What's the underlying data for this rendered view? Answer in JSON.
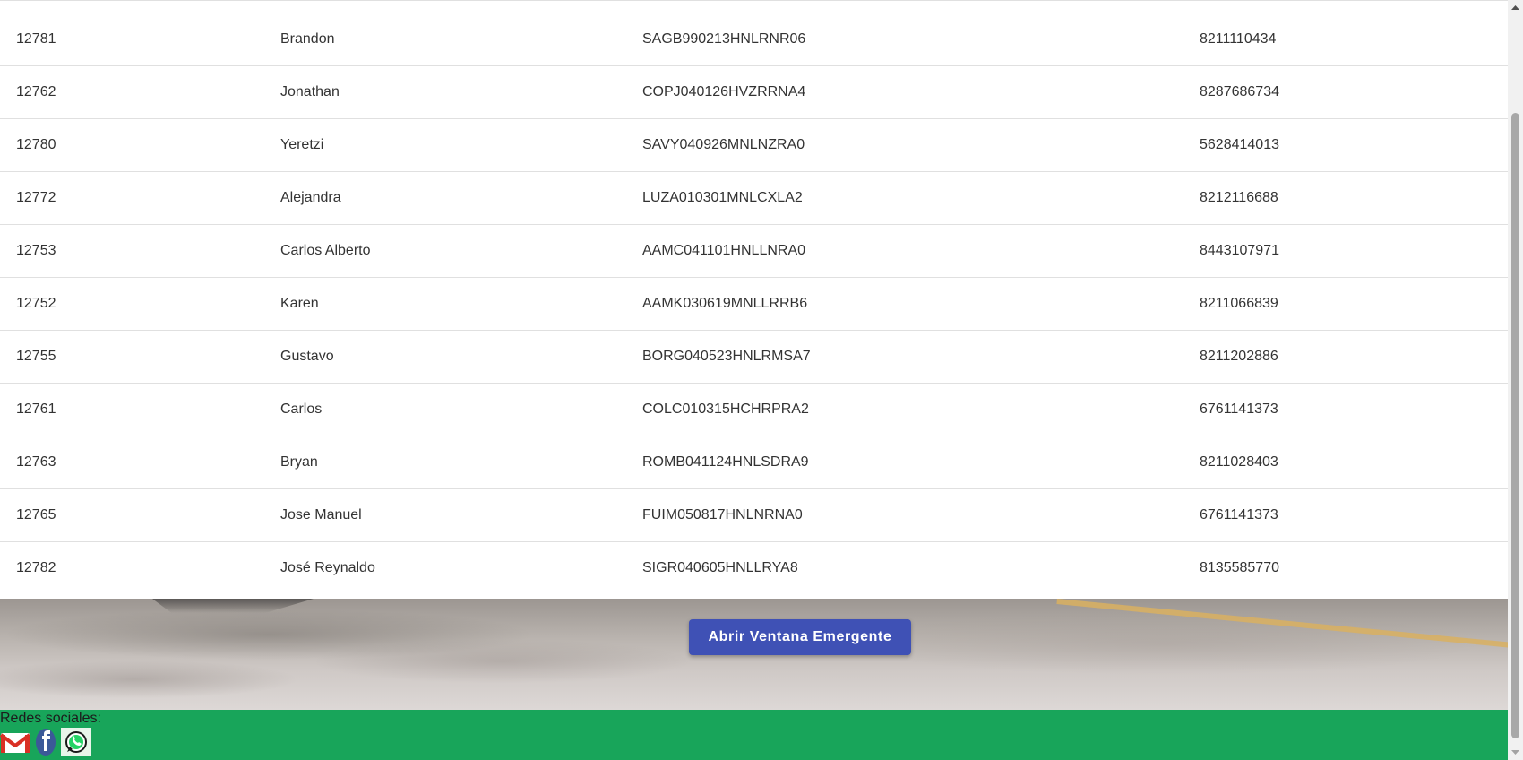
{
  "table": {
    "rows": [
      {
        "id": "12781",
        "name": "Brandon",
        "curp": "SAGB990213HNLRNR06",
        "phone": "8211110434"
      },
      {
        "id": "12762",
        "name": "Jonathan",
        "curp": "COPJ040126HVZRRNA4",
        "phone": "8287686734"
      },
      {
        "id": "12780",
        "name": "Yeretzi",
        "curp": "SAVY040926MNLNZRA0",
        "phone": "5628414013"
      },
      {
        "id": "12772",
        "name": "Alejandra",
        "curp": "LUZA010301MNLCXLA2",
        "phone": "8212116688"
      },
      {
        "id": "12753",
        "name": "Carlos Alberto",
        "curp": "AAMC041101HNLLNRA0",
        "phone": "8443107971"
      },
      {
        "id": "12752",
        "name": "Karen",
        "curp": "AAMK030619MNLLRRB6",
        "phone": "8211066839"
      },
      {
        "id": "12755",
        "name": "Gustavo",
        "curp": "BORG040523HNLRMSA7",
        "phone": "8211202886"
      },
      {
        "id": "12761",
        "name": "Carlos",
        "curp": "COLC010315HCHRPRA2",
        "phone": "6761141373"
      },
      {
        "id": "12763",
        "name": "Bryan",
        "curp": "ROMB041124HNLSDRA9",
        "phone": "8211028403"
      },
      {
        "id": "12765",
        "name": "Jose Manuel",
        "curp": "FUIM050817HNLNRNA0",
        "phone": "6761141373"
      },
      {
        "id": "12782",
        "name": "José Reynaldo",
        "curp": "SIGR040605HNLLRYA8",
        "phone": "8135585770"
      }
    ]
  },
  "popup_button": {
    "label": "Abrir Ventana Emergente",
    "color": "#3f51b5"
  },
  "footer": {
    "label": "Redes sociales:",
    "background": "#18a55a",
    "icons": [
      "gmail-icon",
      "facebook-icon",
      "whatsapp-icon"
    ]
  }
}
